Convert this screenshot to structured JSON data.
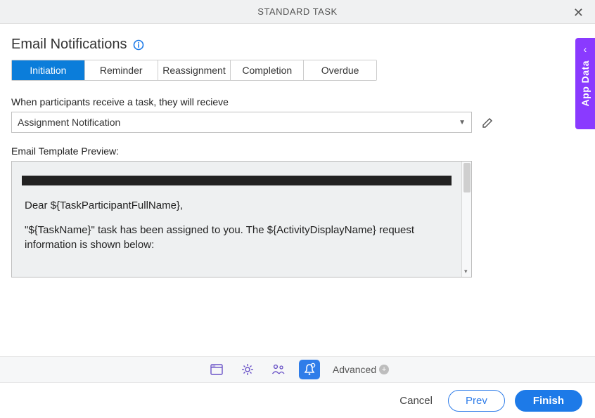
{
  "header": {
    "title": "STANDARD TASK"
  },
  "page": {
    "title": "Email Notifications"
  },
  "tabs": {
    "items": [
      {
        "label": "Initiation",
        "active": true
      },
      {
        "label": "Reminder"
      },
      {
        "label": "Reassignment"
      },
      {
        "label": "Completion"
      },
      {
        "label": "Overdue"
      }
    ]
  },
  "receive": {
    "label": "When participants receive a task, they will recieve",
    "selected": "Assignment Notification"
  },
  "preview": {
    "label": "Email Template Preview:",
    "greeting": "Dear ${TaskParticipantFullName},",
    "body": "\"${TaskName}\" task has been assigned to you. The ${ActivityDisplayName} request information is shown below:"
  },
  "sidepanel": {
    "label": "App Data"
  },
  "bottombar": {
    "advanced": "Advanced"
  },
  "footer": {
    "cancel": "Cancel",
    "prev": "Prev",
    "finish": "Finish"
  }
}
